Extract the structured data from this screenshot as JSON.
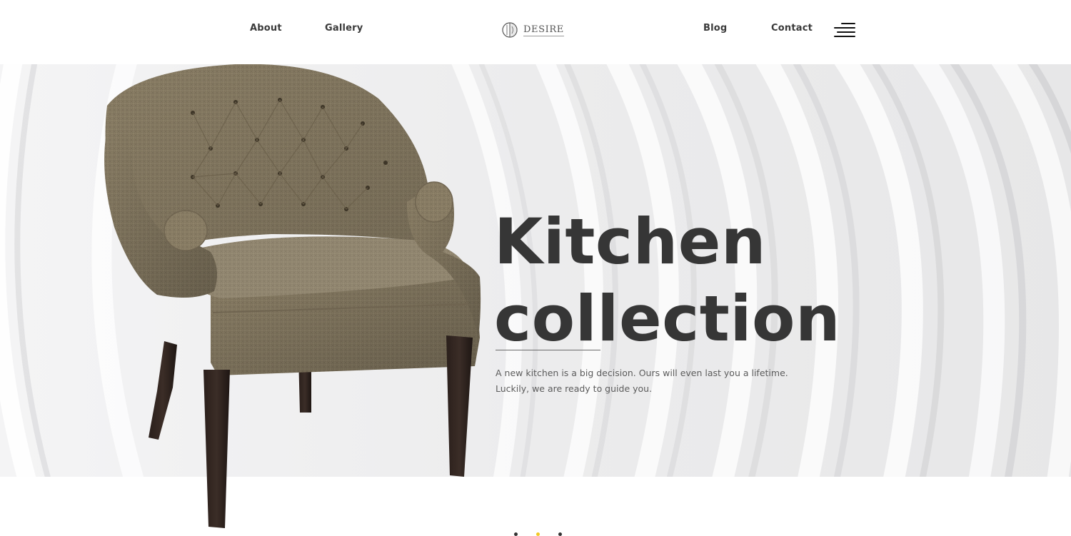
{
  "header": {
    "nav_left": [
      "About",
      "Gallery"
    ],
    "nav_right": [
      "Blog",
      "Contact"
    ],
    "logo_text": "DESIRE",
    "menu_icon": "hamburger-menu-icon"
  },
  "hero": {
    "title_line1": "Kitchen",
    "title_line2": "collection",
    "description": "A new kitchen is a big decision. Ours will even last you a lifetime. Luckily, we are ready to guide you.",
    "image": "armchair-photo"
  },
  "slider": {
    "dot_count": 3,
    "active_index": 1
  },
  "colors": {
    "heading": "#363636",
    "text": "#5c5c5c",
    "accent_dot": "#f2c824",
    "hero_bg": "#eeeeef"
  }
}
